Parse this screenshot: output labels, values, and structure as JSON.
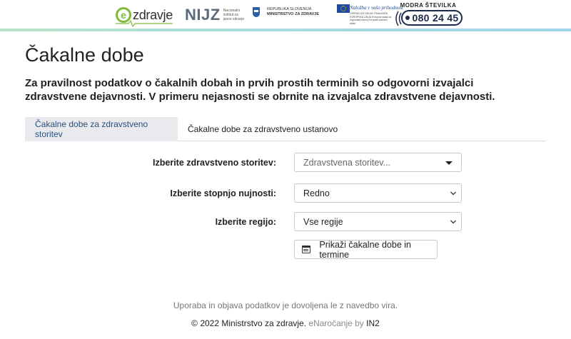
{
  "header": {
    "ezdravje_logo": {
      "text": "zdravje",
      "mark": "e"
    },
    "nijz_logo": {
      "text": "NIJZ",
      "subtitle": "Nacionalni inštitut za javno zdravje"
    },
    "ministry_logo": {
      "line1": "REPUBLIKA SLOVENIJA",
      "line2": "MINISTRSTVO ZA ZDRAVJE"
    },
    "eu_logo": {
      "title": "Naložba v vašo prihodnost",
      "subtitle": "OPERACIJO DELNO FINANCIRA EVROPSKA UNIJA Evropski sklad za regionalni razvoj Evropski socialni sklad"
    },
    "hotline": {
      "label": "MODRA ŠTEVILKA",
      "number": "080 24 45"
    }
  },
  "main": {
    "title": "Čakalne dobe",
    "intro": "Za pravilnost podatkov o čakalnih dobah in prvih prostih terminih so odgovorni izvajalci zdravstvene dejavnosti. V primeru nejasnosti se obrnite na izvajalca zdravstvene dejavnosti.",
    "tabs": [
      {
        "label": "Čakalne dobe za zdravstveno storitev",
        "active": true
      },
      {
        "label": "Čakalne dobe za zdravstveno ustanovo",
        "active": false
      }
    ],
    "form": {
      "service": {
        "label": "Izberite zdravstveno storitev:",
        "placeholder": "Zdravstvena storitev..."
      },
      "urgency": {
        "label": "Izberite stopnjo nujnosti:",
        "value": "Redno"
      },
      "region": {
        "label": "Izberite regijo:",
        "value": "Vse regije"
      },
      "submit_label": "Prikaži čakalne dobe in termine"
    }
  },
  "footer": {
    "note": "Uporaba in objava podatkov je dovoljena le z navedbo vira.",
    "copyright": "© 2022 Ministrstvo za zdravje.",
    "app_name": "eNaročanje",
    "by": "by",
    "vendor": "IN2"
  },
  "colors": {
    "active_tab_bg": "#e8eaed",
    "active_tab_text": "#2a4f7f",
    "header_gradient_start": "#b8e3c8",
    "header_gradient_end": "#9fd3e8"
  }
}
